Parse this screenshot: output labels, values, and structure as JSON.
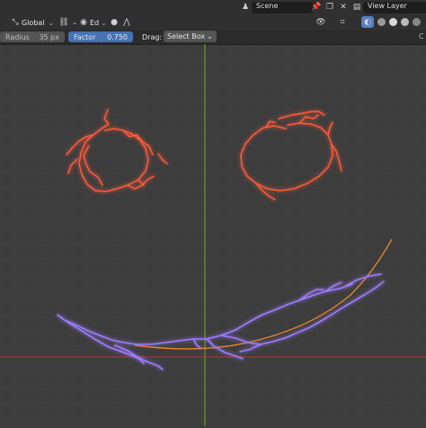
{
  "top_header": {
    "scene_label": "Scene",
    "view_layer_label": "View Layer"
  },
  "tool_header": {
    "transform_orientation": "Global",
    "mode_short": "Ed"
  },
  "tool_settings": {
    "radius_label": "Radius",
    "radius_value": "35 px",
    "factor_label": "Factor",
    "factor_value": "0.750",
    "drag_label": "Drag:",
    "drag_value": "Select Box"
  },
  "icons": {
    "orientation": "transform-orientation-icon",
    "pivot": "pivot-icon",
    "snap": "snap-icon",
    "proportional": "proportional-edit-icon",
    "falloff": "falloff-curve-icon",
    "scene": "scene-icon",
    "pin": "pin-icon",
    "view_layer": "view-layer-icon"
  },
  "colors": {
    "red_stroke": "#ff5a3a",
    "purple_stroke": "#9e7bff",
    "orange_curve": "#e0842b",
    "x_axis": "#a8323f",
    "y_axis": "#6e9a2f"
  }
}
